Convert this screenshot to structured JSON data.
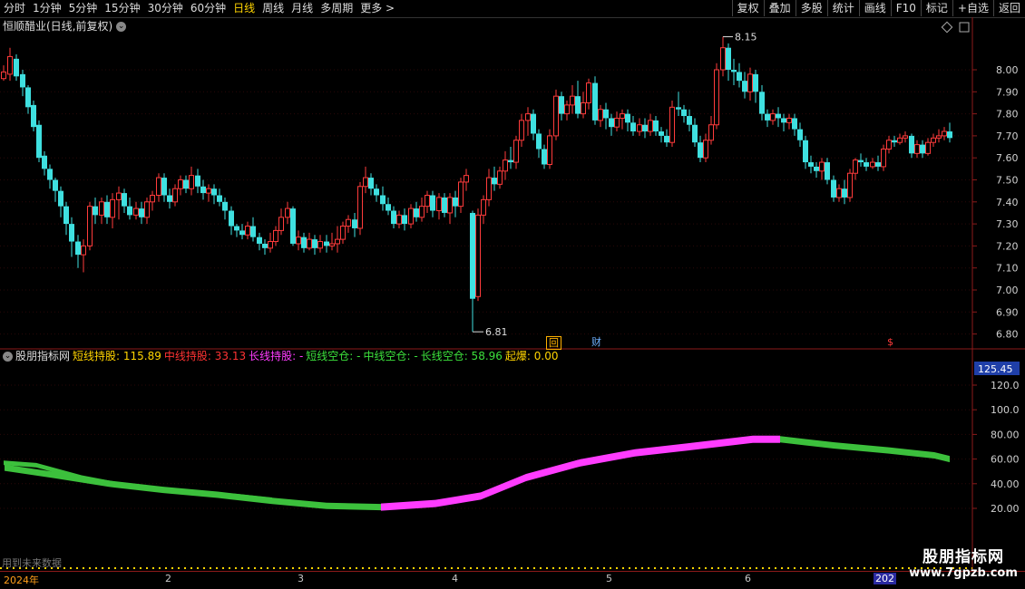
{
  "toolbar": {
    "periods": [
      "分时",
      "1分钟",
      "5分钟",
      "15分钟",
      "30分钟",
      "60分钟",
      "日线",
      "周线",
      "月线",
      "多周期",
      "更多 >"
    ],
    "active_period": "日线",
    "actions": [
      "复权",
      "叠加",
      "多股",
      "统计",
      "画线",
      "F10",
      "标记",
      "+自选",
      "返回"
    ]
  },
  "price_panel": {
    "title": "恒顺醋业(日线,前复权)",
    "high_label": "8.15",
    "low_label": "6.81",
    "y_ticks": [
      "8.00",
      "7.90",
      "7.80",
      "7.70",
      "7.60",
      "7.50",
      "7.40",
      "7.30",
      "7.20",
      "7.10",
      "7.00",
      "6.90",
      "6.80"
    ],
    "badges": {
      "hui": "回",
      "cai": "财",
      "dollar": "$"
    }
  },
  "indicator_panel": {
    "name": "股朋指标网",
    "items": [
      {
        "label": "短线持股:",
        "value": "115.89",
        "color": "#ffd400"
      },
      {
        "label": "中线持股:",
        "value": "33.13",
        "color": "#ff3333"
      },
      {
        "label": "长线持股:",
        "value": "-",
        "color": "#ff3cff"
      },
      {
        "label": "短线空仓:",
        "value": "-",
        "color": "#3ce03c"
      },
      {
        "label": "中线空仓:",
        "value": "-",
        "color": "#3ce03c"
      },
      {
        "label": "长线空仓:",
        "value": "58.96",
        "color": "#3ce03c"
      },
      {
        "label": "起爆:",
        "value": "0.00",
        "color": "#ffd400"
      }
    ],
    "current_value": "125.45",
    "y_ticks": [
      "120.0",
      "100.0",
      "80.00",
      "60.00",
      "40.00",
      "20.00"
    ],
    "hint": "用到未来数据"
  },
  "xaxis": {
    "year": "2024年",
    "months": [
      "2",
      "3",
      "4",
      "5",
      "6"
    ],
    "next_year": "202"
  },
  "watermark": {
    "cn": "股朋指标网",
    "url": "www.7gpzb.com"
  },
  "colors": {
    "up": "#ff3b3b",
    "down": "#3fe0e0",
    "axis": "#8b1a1a",
    "short": "#ff6a2a",
    "mid": "#e02020",
    "long": "#ff3cff",
    "long_empty": "#3cc03c"
  }
}
